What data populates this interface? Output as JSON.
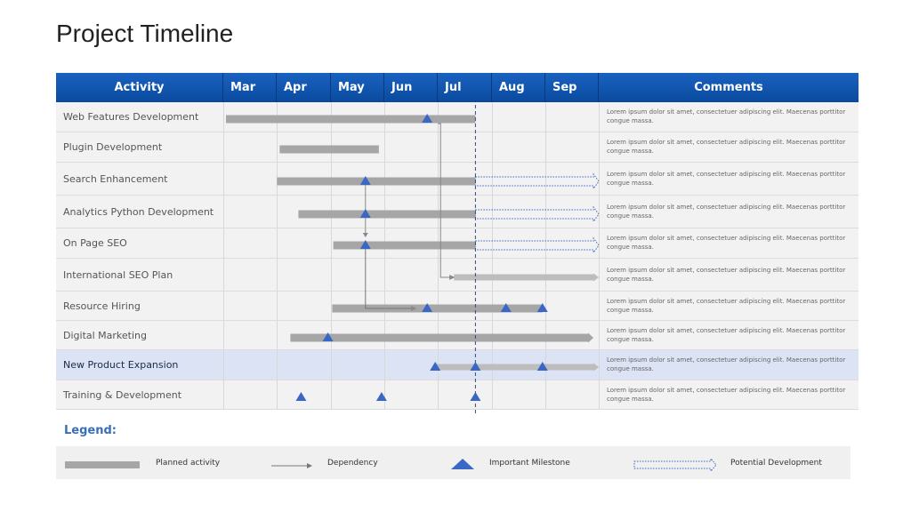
{
  "page": {
    "title": "Project Timeline"
  },
  "header": {
    "activity": "Activity",
    "comments": "Comments",
    "months": [
      "Mar",
      "Apr",
      "May",
      "Jun",
      "Jul",
      "Aug",
      "Sep"
    ]
  },
  "colors": {
    "header": "#0a4a9e",
    "bar": "#a6a6a6",
    "milestone": "#3a66c4",
    "potential": "#3a66c4",
    "highlight": "#dbe3f4"
  },
  "rows": [
    {
      "activity": "Web Features Development",
      "comment": "Lorem ipsum dolor sit amet, consectetuer adipiscing elit. Maecenas porttitor congue massa."
    },
    {
      "activity": "Plugin Development",
      "comment": "Lorem ipsum dolor sit amet, consectetuer adipiscing elit. Maecenas porttitor congue massa."
    },
    {
      "activity": "Search Enhancement",
      "comment": "Lorem ipsum dolor sit amet, consectetuer adipiscing elit. Maecenas porttitor congue massa."
    },
    {
      "activity": "Analytics Python  Development",
      "comment": "Lorem ipsum dolor sit amet, consectetuer adipiscing elit. Maecenas porttitor congue massa."
    },
    {
      "activity": "On Page SEO",
      "comment": "Lorem ipsum dolor sit amet, consectetuer adipiscing elit. Maecenas porttitor congue massa."
    },
    {
      "activity": "International  SEO Plan",
      "comment": "Lorem ipsum dolor sit amet, consectetuer adipiscing elit. Maecenas porttitor congue massa."
    },
    {
      "activity": "Resource Hiring",
      "comment": "Lorem ipsum dolor sit amet, consectetuer adipiscing elit. Maecenas porttitor congue massa."
    },
    {
      "activity": "Digital Marketing",
      "comment": "Lorem ipsum dolor sit amet, consectetuer adipiscing elit. Maecenas porttitor congue massa."
    },
    {
      "activity": "New Product  Expansion",
      "comment": "Lorem ipsum dolor sit amet, consectetuer adipiscing elit. Maecenas porttitor congue massa.",
      "highlighted": true
    },
    {
      "activity": "Training & Development",
      "comment": "Lorem ipsum dolor sit amet, consectetuer adipiscing elit. Maecenas porttitor congue massa."
    }
  ],
  "legend": {
    "title": "Legend:",
    "planned": "Planned activity",
    "dependency": "Dependency",
    "milestone": "Important Milestone",
    "potential": "Potential Development"
  },
  "chart_data": {
    "type": "gantt",
    "title": "Project Timeline",
    "time_axis": [
      "Mar",
      "Apr",
      "May",
      "Jun",
      "Jul",
      "Aug",
      "Sep"
    ],
    "time_unit": "months from start of Mar (0 = Mar 1, 7 = end of Sep)",
    "today_marker": 4.7,
    "tasks": [
      {
        "name": "Web Features Development",
        "start": 0.05,
        "end": 4.7,
        "arrow": false,
        "milestones": [
          3.8
        ],
        "potential_to": null
      },
      {
        "name": "Plugin Development",
        "start": 1.05,
        "end": 2.9,
        "arrow": false,
        "milestones": [],
        "potential_to": null
      },
      {
        "name": "Search Enhancement",
        "start": 1.0,
        "end": 4.7,
        "arrow": false,
        "milestones": [
          2.65
        ],
        "potential_to": 7.0
      },
      {
        "name": "Analytics Python  Development",
        "start": 1.4,
        "end": 4.7,
        "arrow": false,
        "milestones": [
          2.65
        ],
        "potential_to": 7.0
      },
      {
        "name": "On Page SEO",
        "start": 2.05,
        "end": 4.7,
        "arrow": false,
        "milestones": [
          2.65
        ],
        "potential_to": 7.0
      },
      {
        "name": "International  SEO Plan",
        "start": 4.3,
        "end": 7.0,
        "arrow": true,
        "light": true,
        "milestones": [],
        "potential_to": null
      },
      {
        "name": "Resource Hiring",
        "start": 2.03,
        "end": 5.95,
        "arrow": false,
        "milestones": [
          3.8,
          5.27,
          5.95
        ],
        "potential_to": null
      },
      {
        "name": "Digital Marketing",
        "start": 1.25,
        "end": 6.9,
        "arrow": true,
        "milestones": [
          1.95
        ],
        "potential_to": null
      },
      {
        "name": "New Product  Expansion",
        "start": 3.95,
        "end": 7.0,
        "arrow": true,
        "light": true,
        "milestones": [
          3.95,
          4.7,
          5.95
        ],
        "potential_to": null
      },
      {
        "name": "Training & Development",
        "start": null,
        "end": null,
        "arrow": false,
        "milestones": [
          1.45,
          2.95,
          4.7
        ],
        "potential_to": null
      }
    ],
    "dependencies": [
      {
        "from_task": 0,
        "to_task": 5,
        "at": 4.05
      },
      {
        "from_task": 2,
        "to_task": 4,
        "at": 2.65
      },
      {
        "from_task": 4,
        "to_task": 6,
        "at": 2.65,
        "end": 3.5
      }
    ]
  }
}
